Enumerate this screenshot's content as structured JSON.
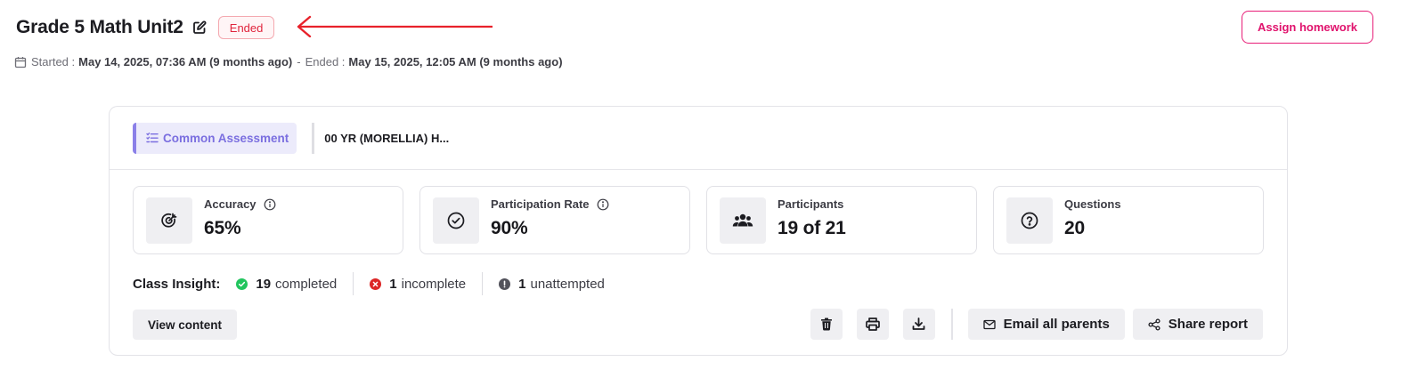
{
  "header": {
    "title": "Grade 5 Math Unit2",
    "status": "Ended",
    "assign_label": "Assign homework",
    "started_label": "Started :",
    "started_value": "May 14, 2025, 07:36 AM (9 months ago)",
    "separator": "-",
    "ended_label": "Ended :",
    "ended_value": "May 15, 2025, 12:05 AM (9 months ago)"
  },
  "assessment": {
    "type_label": "Common Assessment",
    "class_name": "00 YR (MORELLIA) H..."
  },
  "stats": [
    {
      "label": "Accuracy",
      "value": "65%",
      "icon": "target-icon",
      "info": true
    },
    {
      "label": "Participation Rate",
      "value": "90%",
      "icon": "check-circle-icon",
      "info": true
    },
    {
      "label": "Participants",
      "value": "19 of 21",
      "icon": "users-icon",
      "info": false
    },
    {
      "label": "Questions",
      "value": "20",
      "icon": "question-circle-icon",
      "info": false
    }
  ],
  "insight": {
    "label": "Class Insight:",
    "completed_count": "19",
    "completed_text": "completed",
    "incomplete_count": "1",
    "incomplete_text": "incomplete",
    "unattempted_count": "1",
    "unattempted_text": "unattempted"
  },
  "actions": {
    "view_content": "View content",
    "email_parents": "Email all parents",
    "share_report": "Share report"
  },
  "colors": {
    "accent_pink": "#e0136d",
    "status_red": "#e0243c",
    "chip_purple": "#7b6fe0",
    "success_green": "#22c55e",
    "error_red": "#dc2626",
    "neutral_gray": "#52525b"
  }
}
